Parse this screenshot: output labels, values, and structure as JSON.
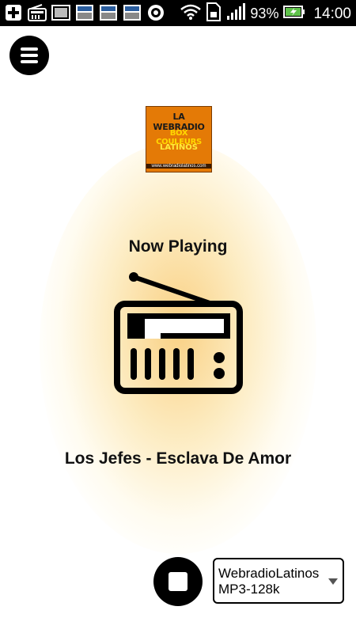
{
  "status_bar": {
    "battery_percent": "93%",
    "time": "14:00",
    "icons": [
      "add-icon",
      "radio-icon",
      "image-icon",
      "news-icon",
      "news-icon",
      "news-icon",
      "record-icon",
      "wifi-icon",
      "sim-icon",
      "signal-icon",
      "battery-icon"
    ]
  },
  "logo": {
    "line1": "LA WEBRADIO",
    "line2": "BOX COULEURS",
    "line3": "LATINOS",
    "line4": "www.webradiolatinos.com"
  },
  "player": {
    "now_playing_label": "Now Playing",
    "song": "Los Jefes - Esclava De Amor"
  },
  "stream_select": {
    "selected": "WebradioLatinos MP3-128k"
  },
  "colors": {
    "glow": "#f5aa1e",
    "button": "#000000"
  }
}
